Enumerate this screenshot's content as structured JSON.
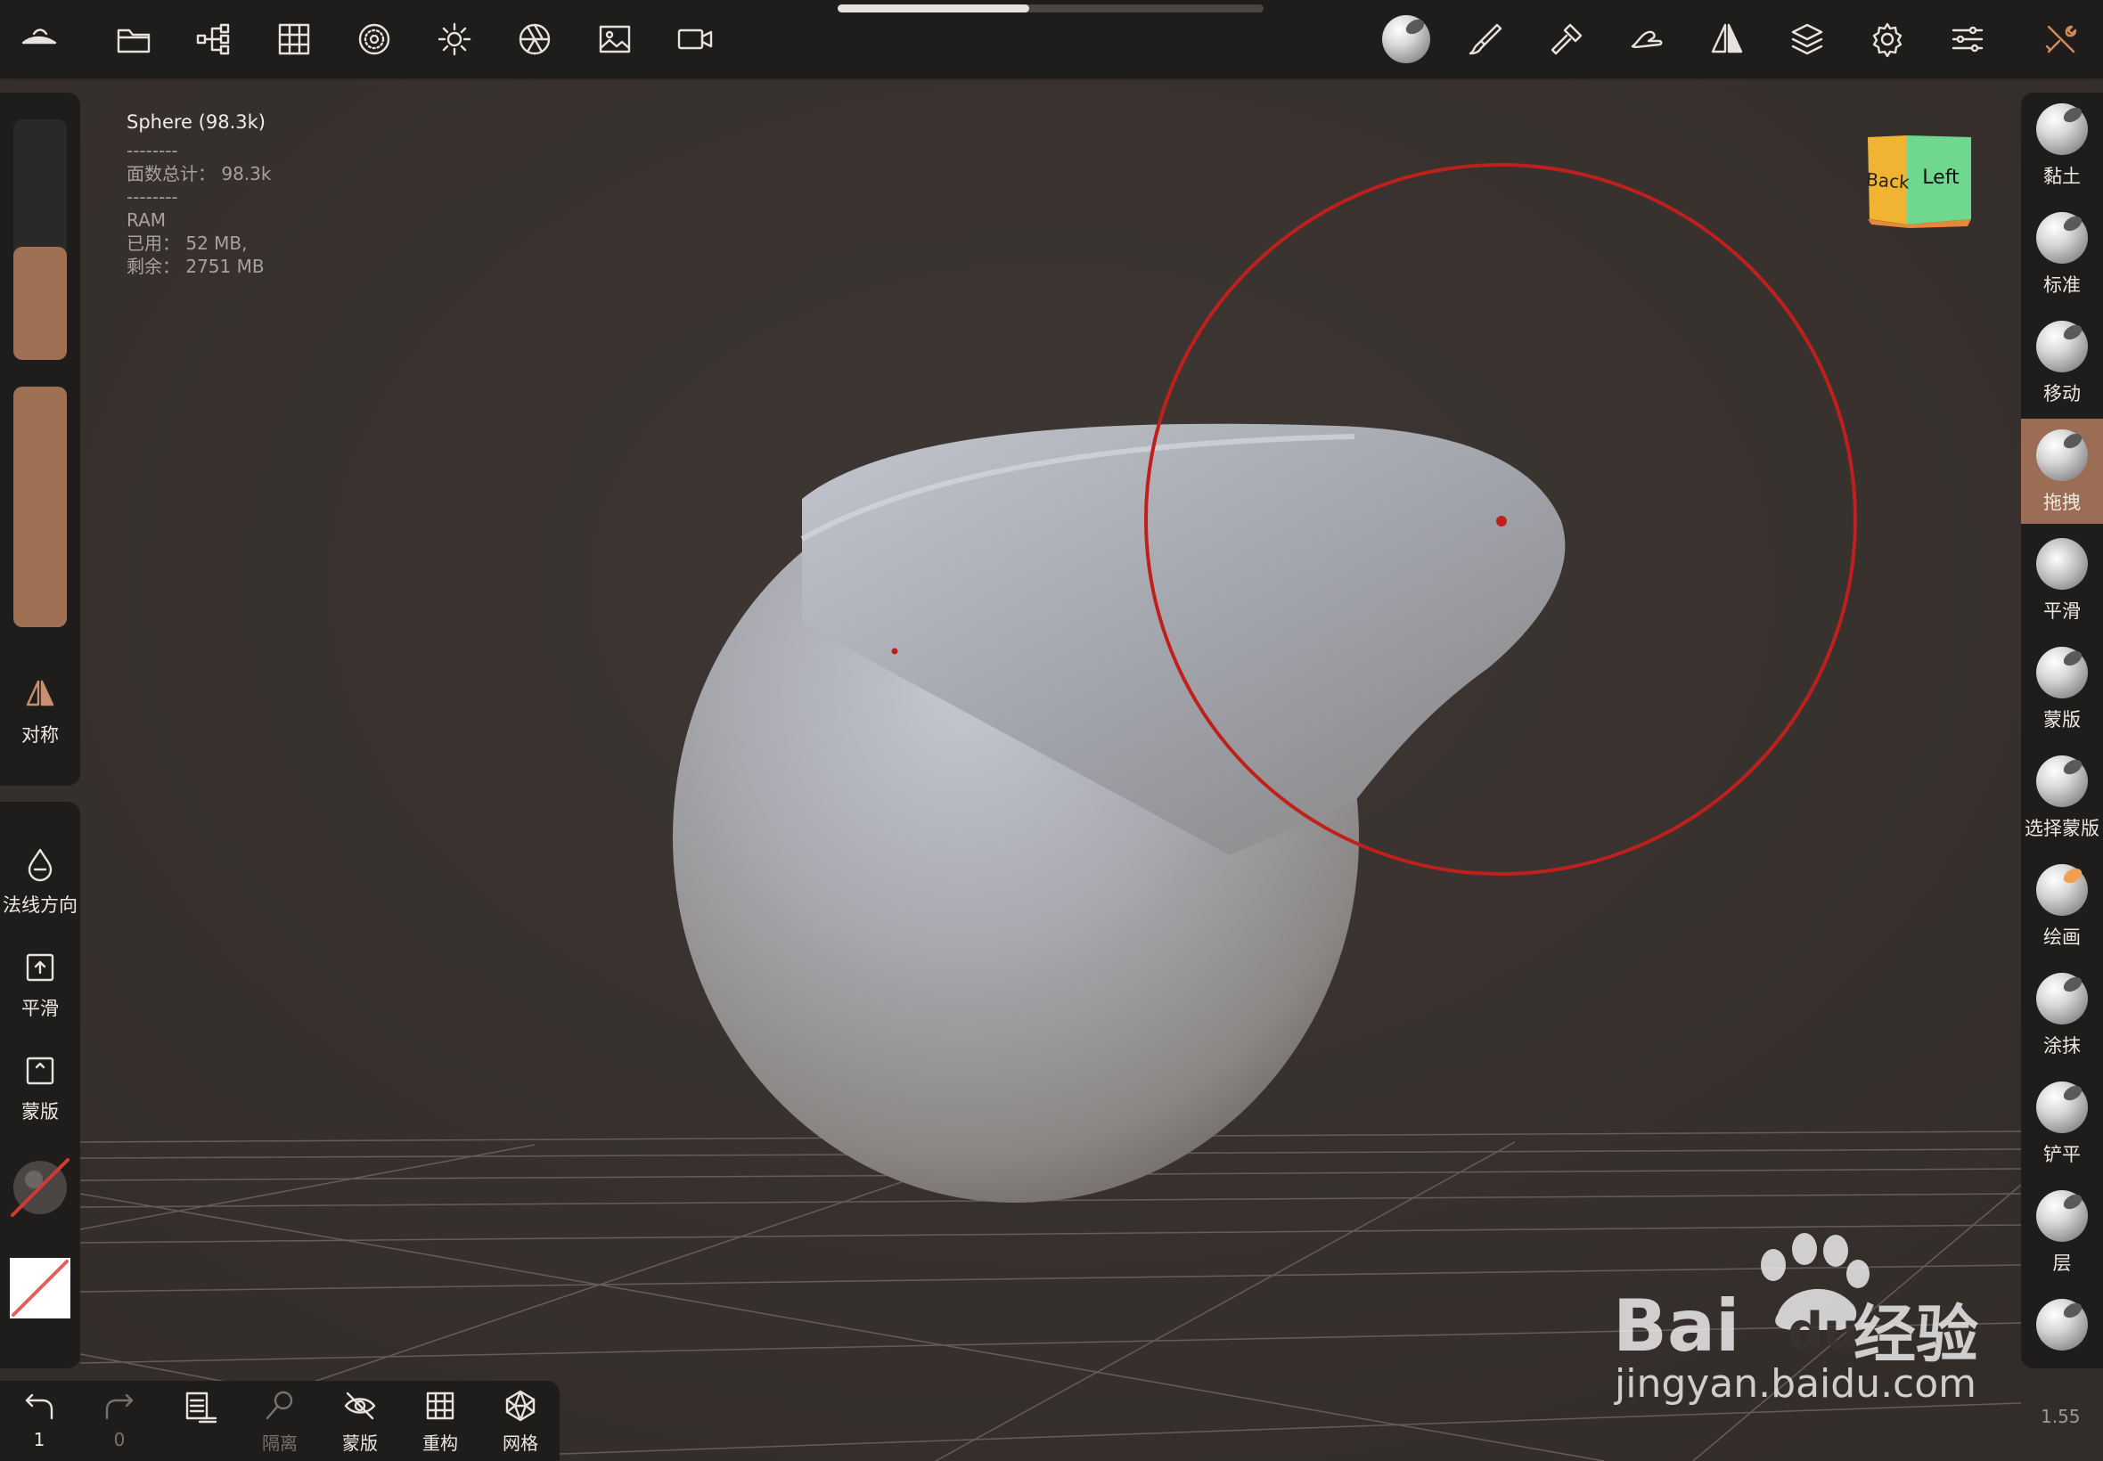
{
  "app": {
    "version": "1.55"
  },
  "topbar": {
    "progress_fraction": 0.45,
    "left_icons": [
      "app-logo-icon",
      "folder-icon",
      "scene-tree-icon",
      "grid-icon",
      "material-sphere-icon",
      "light-icon",
      "camera-aperture-icon",
      "image-icon",
      "video-camera-icon"
    ],
    "right_icons": [
      "current-tool-ball-icon",
      "brush-icon",
      "hammer-icon",
      "hand-icon",
      "symmetry-icon",
      "layers-icon",
      "settings-gear-icon",
      "sliders-icon",
      "tools-wrench-icon"
    ]
  },
  "stats": {
    "object": "Sphere (98.3k)",
    "sep1": "--------",
    "faces": "面数总计：  98.3k",
    "sep2": "--------",
    "ram": "RAM",
    "used": "已用：  52 MB,",
    "free": "剩余：  2751 MB"
  },
  "view_cube": {
    "back": "Back",
    "left": "Left"
  },
  "left_panel": {
    "radius_value": 0.47,
    "intensity_value": 1.0,
    "symmetry_label": "对称",
    "normal_label": "法线方向",
    "smooth_label": "平滑",
    "mask_label": "蒙版"
  },
  "bottom_bar": {
    "undo_count": "1",
    "redo_count": "0",
    "isolate_label": "隔离",
    "mask_label": "蒙版",
    "remesh_label": "重构",
    "mesh_label": "网格"
  },
  "tools": [
    {
      "label": "黏土",
      "icon": "clay-ball-icon",
      "active": false
    },
    {
      "label": "标准",
      "icon": "standard-ball-icon",
      "active": false
    },
    {
      "label": "移动",
      "icon": "move-ball-icon",
      "active": false
    },
    {
      "label": "拖拽",
      "icon": "drag-ball-icon",
      "active": true
    },
    {
      "label": "平滑",
      "icon": "smooth-ball-icon",
      "active": false
    },
    {
      "label": "蒙版",
      "icon": "mask-ball-icon",
      "active": false
    },
    {
      "label": "选择蒙版",
      "icon": "select-mask-ball-icon",
      "active": false
    },
    {
      "label": "绘画",
      "icon": "paint-ball-icon",
      "active": false
    },
    {
      "label": "涂抹",
      "icon": "smudge-icon",
      "active": false
    },
    {
      "label": "铲平",
      "icon": "flatten-ball-icon",
      "active": false
    },
    {
      "label": "层",
      "icon": "layer-ball-icon",
      "active": false
    },
    {
      "label": "",
      "icon": "more-tool-ball-icon",
      "active": false
    }
  ],
  "watermark": {
    "brand_left": "Bai",
    "brand_right": "du",
    "brand_cn": "经验",
    "url": "jingyan.baidu.com"
  },
  "colors": {
    "accent": "#a07055",
    "panel": "#1f1d1c",
    "background": "#3a3330",
    "brush_circle": "#c0201c"
  }
}
